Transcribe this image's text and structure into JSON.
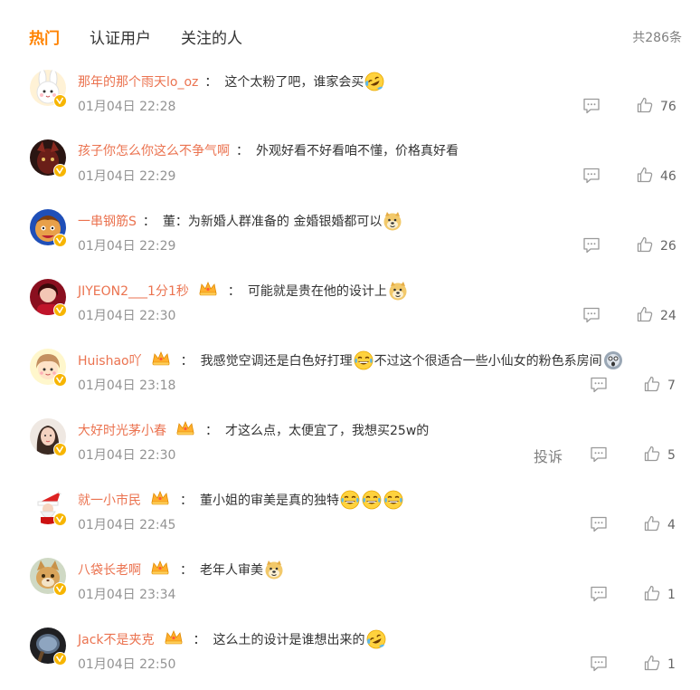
{
  "tabs": [
    {
      "label": "热门",
      "active": true
    },
    {
      "label": "认证用户",
      "active": false
    },
    {
      "label": "关注的人",
      "active": false
    }
  ],
  "total_label": "共286条",
  "report_label": "投诉",
  "colors": {
    "accent": "#ff8200",
    "username": "#eb7350",
    "badge": "#f7b500"
  },
  "comments": [
    {
      "username": "那年的那个雨天lo_oz",
      "has_crown": false,
      "text_parts": [
        "这个太粉了吧，谁家会买",
        {
          "emoji": "laugh-tears"
        }
      ],
      "time": "01月04日 22:28",
      "likes": "76",
      "show_report": false,
      "avatar": "rabbit"
    },
    {
      "username": "孩子你怎么你这么不争气啊",
      "has_crown": false,
      "text_parts": [
        "外观好看不好看咱不懂，价格真好看"
      ],
      "time": "01月04日 22:29",
      "likes": "46",
      "show_report": false,
      "avatar": "dark"
    },
    {
      "username": "一串钢筋S",
      "has_crown": false,
      "text_parts": [
        "董：为新婚人群准备的 金婚银婚都可以",
        {
          "emoji": "doge"
        }
      ],
      "time": "01月04日 22:29",
      "likes": "26",
      "show_report": false,
      "avatar": "cartoon"
    },
    {
      "username": "JIYEON2___1分1秒",
      "has_crown": true,
      "text_parts": [
        "可能就是贵在他的设计上",
        {
          "emoji": "doge"
        }
      ],
      "time": "01月04日 22:30",
      "likes": "24",
      "show_report": false,
      "avatar": "red"
    },
    {
      "username": "Huishao吖",
      "has_crown": true,
      "text_parts": [
        "我感觉空调还是白色好打理",
        {
          "emoji": "grin-tears"
        },
        "不过这个很适合一些小仙女的粉色系房间",
        {
          "emoji": "shock"
        }
      ],
      "time": "01月04日 23:18",
      "likes": "7",
      "show_report": false,
      "avatar": "girl"
    },
    {
      "username": "大好时光茅小春",
      "has_crown": true,
      "text_parts": [
        "才这么点，太便宜了，我想买25w的"
      ],
      "time": "01月04日 22:30",
      "likes": "5",
      "show_report": true,
      "avatar": "photo"
    },
    {
      "username": "就一小市民",
      "has_crown": true,
      "text_parts": [
        "董小姐的审美是真的独特",
        {
          "emoji": "grin-tears"
        },
        {
          "emoji": "grin-tears"
        },
        {
          "emoji": "grin-tears"
        }
      ],
      "time": "01月04日 22:45",
      "likes": "4",
      "show_report": false,
      "avatar": "santa"
    },
    {
      "username": "八袋长老啊",
      "has_crown": true,
      "text_parts": [
        "老年人审美",
        {
          "emoji": "doge"
        }
      ],
      "time": "01月04日 23:34",
      "likes": "1",
      "show_report": false,
      "avatar": "cat"
    },
    {
      "username": "Jack不是夹克",
      "has_crown": true,
      "text_parts": [
        "这么土的设计是谁想出来的",
        {
          "emoji": "laugh-tears"
        }
      ],
      "time": "01月04日 22:50",
      "likes": "1",
      "show_report": false,
      "avatar": "mirror"
    }
  ]
}
